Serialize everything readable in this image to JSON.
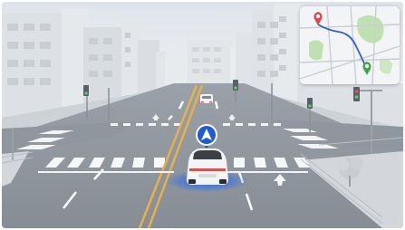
{
  "scene": {
    "description_label": "",
    "colors": {
      "sky": "#eef1f4",
      "road": "#8e959c",
      "road_dark": "#7f868d",
      "lane_yellow": "#e7b14a",
      "marking_white": "#ffffff",
      "vehicle_body": "#f4f5f7",
      "accent_blue": "#1f5bd8",
      "tree_green": "#6f9f5e"
    }
  },
  "vehicle_marker": {
    "icon": "navigation-arrow-icon",
    "color": "#1f5bd8"
  },
  "minimap": {
    "start_pin_icon": "map-pin-red-icon",
    "end_pin_icon": "map-pin-green-icon",
    "route_color": "#2f5fd1",
    "park_color": "#bfe0b0",
    "street_color": "#c9ced4"
  }
}
